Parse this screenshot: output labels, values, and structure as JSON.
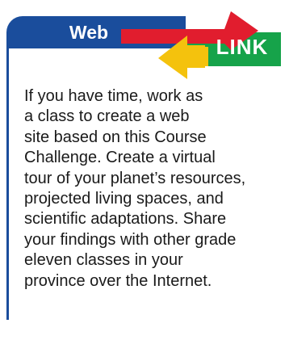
{
  "feature": {
    "title": "Web",
    "badge": "LINK",
    "colors": {
      "banner_blue": "#1a4d9c",
      "link_green": "#16a34a",
      "arrow_red": "#e11d2e",
      "arrow_yellow": "#f4c20d"
    }
  },
  "content": {
    "paragraph": "If you have time, work as\na class to create a web\nsite based on this Course\nChallenge. Create a virtual\ntour of your planet’s resources,\nprojected living spaces, and\nscientific adaptations. Share\nyour findings with other grade\neleven classes in your\nprovince over the Internet."
  }
}
